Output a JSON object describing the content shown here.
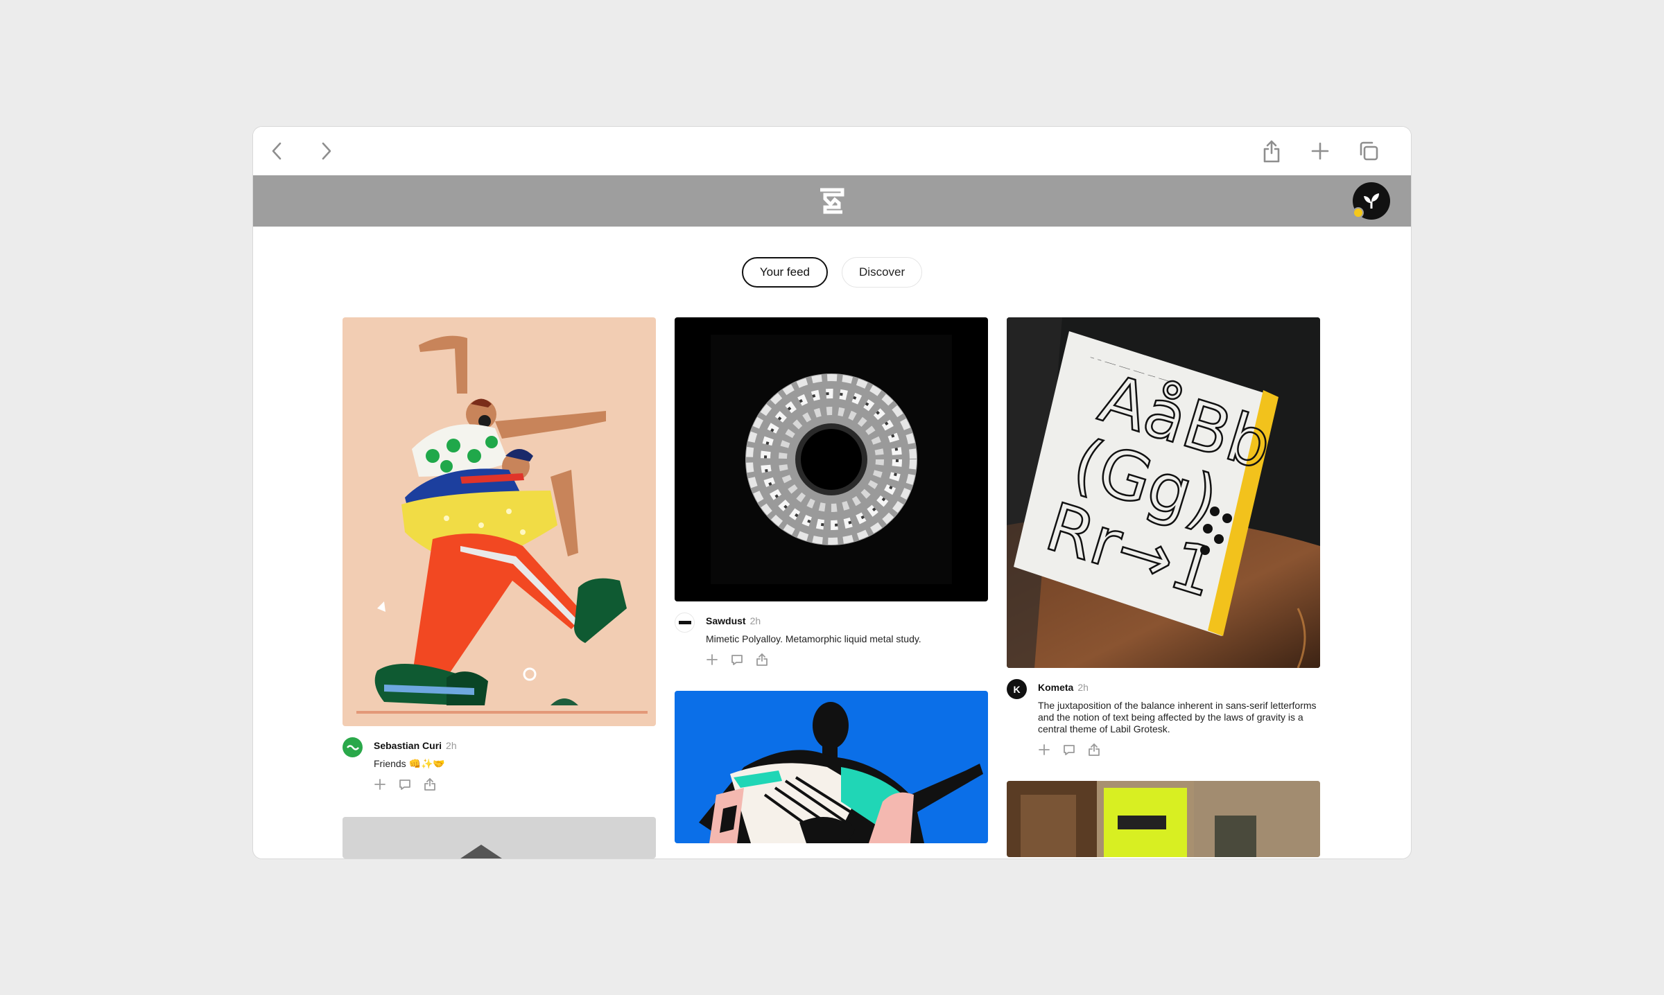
{
  "browser": {
    "back_icon": "chevron-left-icon",
    "forward_icon": "chevron-right-icon",
    "share_icon": "share-icon",
    "new_tab_icon": "plus-icon",
    "tabs_icon": "tabs-icon"
  },
  "app": {
    "logo_icon": "app-logo-icon",
    "avatar_icon": "leaf-avatar-icon",
    "notification_color": "#f4c81b",
    "bar_color": "#9e9e9e"
  },
  "tabs": [
    {
      "label": "Your feed",
      "active": true
    },
    {
      "label": "Discover",
      "active": false
    }
  ],
  "posts": [
    {
      "author": "Sebastian Curi",
      "time": "2h",
      "text": "Friends 👊✨🤝",
      "image": "illustration-two-dancers"
    },
    {
      "author": "Sawdust",
      "time": "2h",
      "text": "Mimetic Polyalloy. Metamorphic liquid metal study.",
      "image": "liquid-metal-ring"
    },
    {
      "author": "Kometa",
      "avatar_letter": "K",
      "time": "2h",
      "text": "The juxtaposition of the balance inherent in sans-serif letterforms and the notion of text being affected by the laws of gravity is a central theme of Labil Grotesk.",
      "image": "typeface-specimen-book",
      "specimen_text": [
        "AåBb",
        "(Gg)",
        "Rr→1"
      ]
    },
    {
      "image": "figure-on-blue"
    },
    {
      "image": "grey-object"
    },
    {
      "image": "neon-blocks"
    }
  ],
  "actions": {
    "add_icon": "plus-icon",
    "comment_icon": "comment-icon",
    "share_icon": "share-icon"
  }
}
